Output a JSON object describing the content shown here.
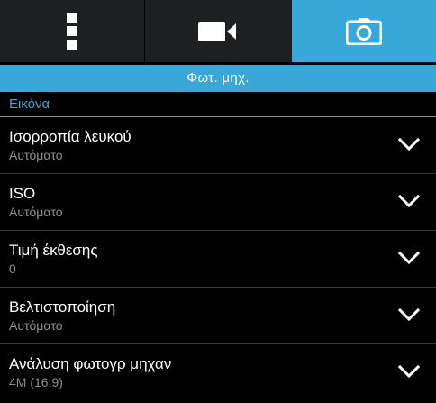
{
  "tabs": [
    {
      "name": "more-settings",
      "icon": "vertical-dots-icon",
      "selected": false
    },
    {
      "name": "video",
      "icon": "video-camera-icon",
      "selected": false
    },
    {
      "name": "photo",
      "icon": "camera-icon",
      "selected": true
    }
  ],
  "mode_title": "Φωτ. μηχ.",
  "section_title": "Εικόνα",
  "settings": [
    {
      "title": "Ισορροπία λευκού",
      "value": "Αυτόματο",
      "icon": "chevron-down-icon"
    },
    {
      "title": "ISO",
      "value": "Αυτόματο",
      "icon": "chevron-down-icon"
    },
    {
      "title": "Τιμή έκθεσης",
      "value": "0",
      "icon": "chevron-down-icon"
    },
    {
      "title": "Βελτιστοποίηση",
      "value": "Αυτόματο",
      "icon": "chevron-down-icon"
    },
    {
      "title": "Ανάλυση φωτογρ μηχαν",
      "value": "4M (16:9)",
      "icon": "chevron-down-icon"
    }
  ],
  "colors": {
    "accent": "#39a7d7",
    "tab_bar": "#1e1f20",
    "background": "#000000",
    "secondary_text": "#8d8d8d"
  }
}
